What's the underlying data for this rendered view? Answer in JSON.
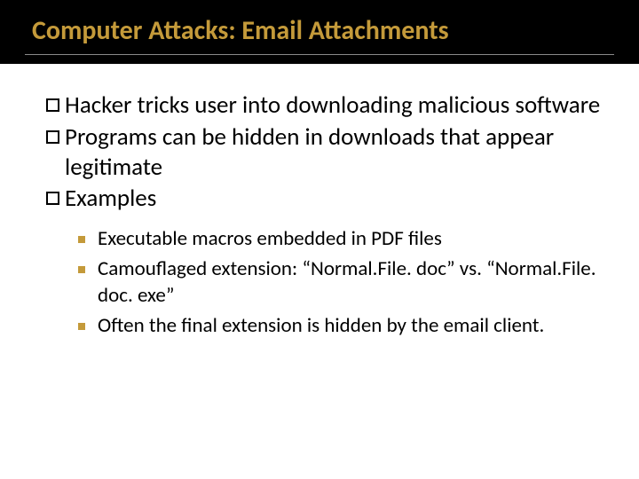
{
  "title": "Computer Attacks: Email Attachments",
  "bullets": [
    {
      "text": "Hacker tricks user into downloading malicious software"
    },
    {
      "text": "Programs can be hidden in downloads that appear legitimate"
    },
    {
      "text": "Examples"
    }
  ],
  "sub_bullets": [
    {
      "text": "Executable macros embedded in PDF files"
    },
    {
      "text": "Camouflaged extension: “Normal.File. doc” vs. “Normal.File. doc. exe”"
    },
    {
      "text": "Often the final extension is hidden by the email client."
    }
  ]
}
